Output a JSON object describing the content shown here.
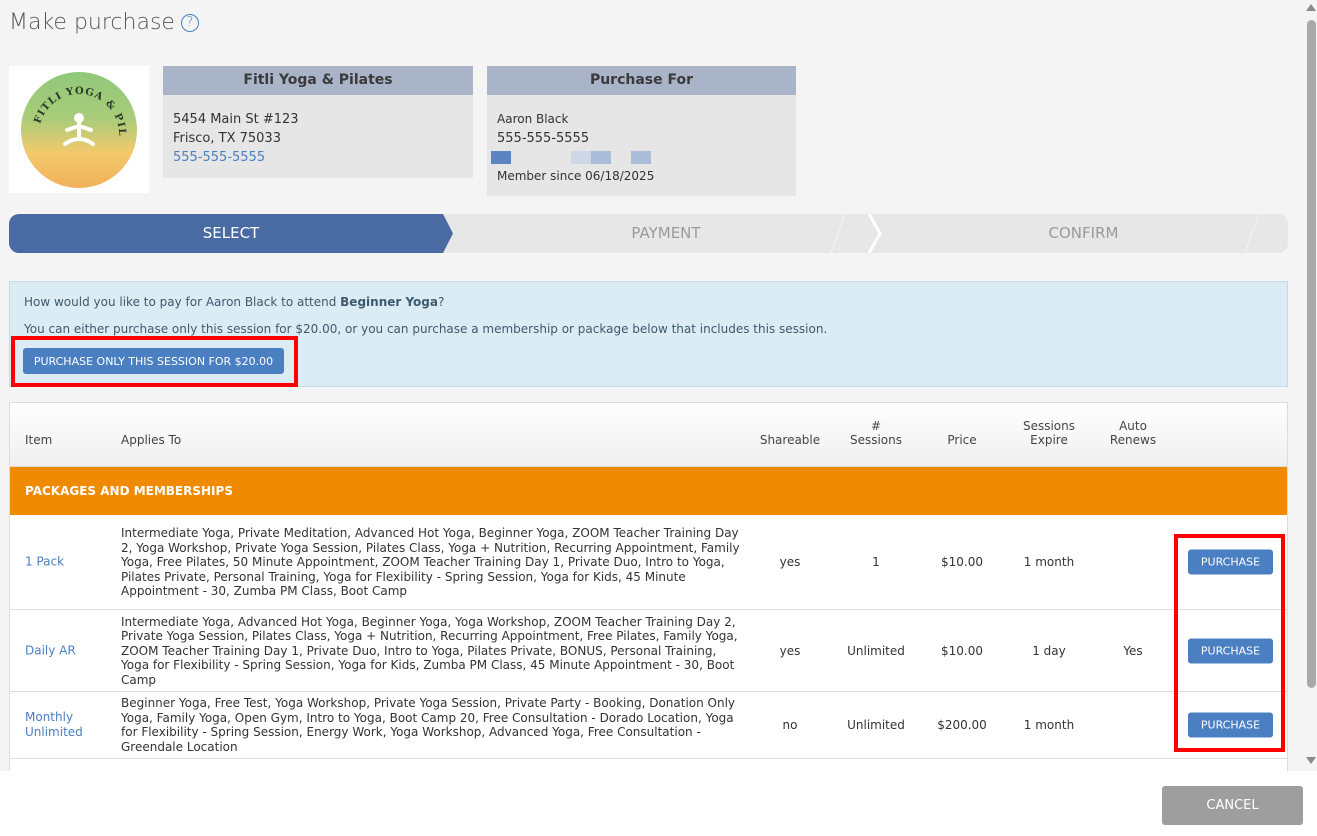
{
  "header": {
    "title": "Make purchase",
    "help_icon": "question-circle-icon"
  },
  "studio": {
    "logo_text": "FITLI YOGA & PILATES",
    "name": "Fitli Yoga & Pilates",
    "address1": "5454 Main St #123",
    "address2": "Frisco, TX 75033",
    "phone": "555-555-5555"
  },
  "purchase_for": {
    "heading": "Purchase For",
    "name": "Aaron Black",
    "phone": "555-555-5555",
    "member_since": "Member since 06/18/2025"
  },
  "steps": [
    "SELECT",
    "PAYMENT",
    "CONFIRM"
  ],
  "info": {
    "question_prefix": "How would you like to pay for Aaron Black to attend ",
    "class_name": "Beginner Yoga",
    "question_suffix": "?",
    "line2": "You can either purchase only this session for $20.00, or you can purchase a membership or package below that includes this session.",
    "session_button": "PURCHASE ONLY THIS SESSION FOR $20.00"
  },
  "table": {
    "headers": {
      "item": "Item",
      "applies_to": "Applies To",
      "shareable": "Shareable",
      "sessions_l1": "#",
      "sessions_l2": "Sessions",
      "price": "Price",
      "expire_l1": "Sessions",
      "expire_l2": "Expire",
      "auto_l1": "Auto",
      "auto_l2": "Renews"
    },
    "section": "PACKAGES AND MEMBERSHIPS",
    "rows": [
      {
        "item": "1 Pack",
        "applies": "Intermediate Yoga, Private Meditation, Advanced Hot Yoga, Beginner Yoga, ZOOM Teacher Training Day 2, Yoga Workshop, Private Yoga Session, Pilates Class, Yoga + Nutrition, Recurring Appointment, Family Yoga, Free Pilates, 50 Minute Appointment, ZOOM Teacher Training Day 1, Private Duo, Intro to Yoga, Pilates Private, Personal Training, Yoga for Flexibility - Spring Session, Yoga for Kids, 45 Minute Appointment - 30, Zumba PM Class, Boot Camp",
        "shareable": "yes",
        "sessions": "1",
        "price": "$10.00",
        "expire": "1 month",
        "auto": "",
        "button": "PURCHASE"
      },
      {
        "item": "Daily AR",
        "applies": "Intermediate Yoga, Advanced Hot Yoga, Beginner Yoga, Yoga Workshop, ZOOM Teacher Training Day 2, Private Yoga Session, Pilates Class, Yoga + Nutrition, Recurring Appointment, Free Pilates, Family Yoga, ZOOM Teacher Training Day 1, Private Duo, Intro to Yoga, Pilates Private, BONUS, Personal Training, Yoga for Flexibility - Spring Session, Yoga for Kids, Zumba PM Class, 45 Minute Appointment - 30, Boot Camp",
        "shareable": "yes",
        "sessions": "Unlimited",
        "price": "$10.00",
        "expire": "1 day",
        "auto": "Yes",
        "button": "PURCHASE"
      },
      {
        "item": "Monthly Unlimited",
        "applies": "Beginner Yoga, Free Test, Yoga Workshop, Private Yoga Session, Private Party - Booking, Donation Only Yoga, Family Yoga, Open Gym, Intro to Yoga, Boot Camp 20, Free Consultation - Dorado Location, Yoga for Flexibility - Spring Session, Energy Work, Yoga Workshop, Advanced Yoga, Free Consultation - Greendale Location",
        "shareable": "no",
        "sessions": "Unlimited",
        "price": "$200.00",
        "expire": "1 month",
        "auto": "",
        "button": "PURCHASE"
      }
    ]
  },
  "footer": {
    "cancel": "CANCEL"
  },
  "colors": {
    "accent": "#4a7fc1",
    "step_active": "#4a6aa3",
    "section": "#f08a00",
    "highlight": "#ff0000"
  }
}
